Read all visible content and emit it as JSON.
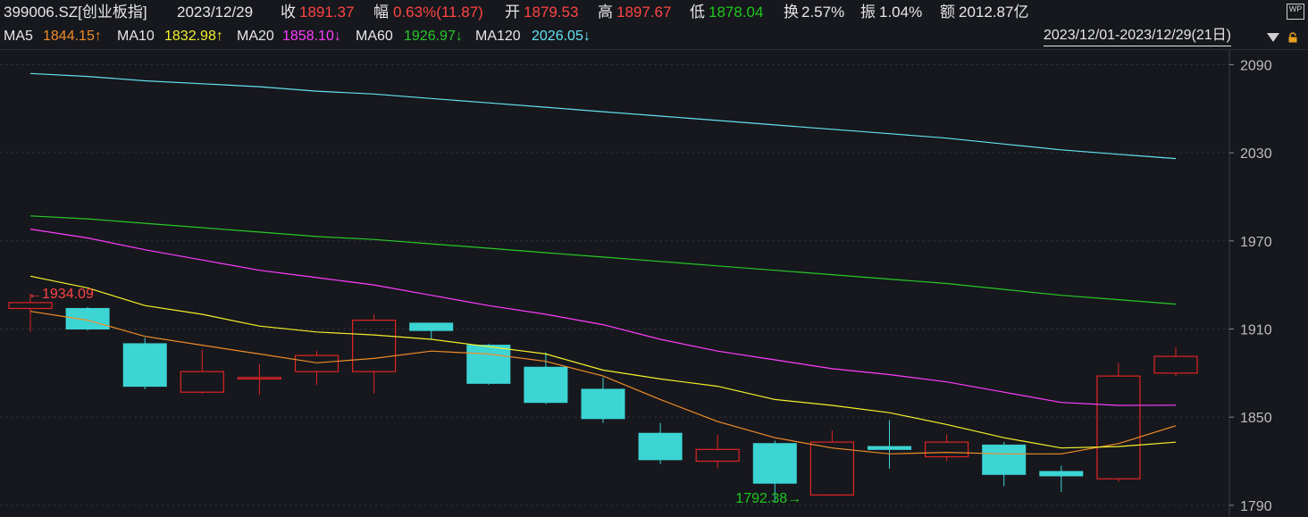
{
  "header": {
    "code": "399006.SZ[创业板指]",
    "date": "2023/12/29",
    "close_label": "收",
    "close_value": "1891.37",
    "change_label": "幅",
    "change_value": "0.63%(11.87)",
    "open_label": "开",
    "open_value": "1879.53",
    "high_label": "高",
    "high_value": "1897.67",
    "low_label": "低",
    "low_value": "1878.04",
    "turnover_label": "换",
    "turnover_value": "2.57%",
    "amplitude_label": "振",
    "amplitude_value": "1.04%",
    "amount_label": "额",
    "amount_value": "2012.87亿",
    "wp_icon_text": "WP"
  },
  "ma_bar": {
    "ma5_label": "MA5",
    "ma5_value": "1844.15↑",
    "ma10_label": "MA10",
    "ma10_value": "1832.98↑",
    "ma20_label": "MA20",
    "ma20_value": "1858.10↓",
    "ma60_label": "MA60",
    "ma60_value": "1926.97↓",
    "ma120_label": "MA120",
    "ma120_value": "2026.05↓",
    "range_text": "2023/12/01-2023/12/29(21日)"
  },
  "colors": {
    "up": "#e02424",
    "down": "#3dd4d4",
    "ma5": "#f08c28",
    "ma10": "#f5f02d",
    "ma20": "#ff3cff",
    "ma60": "#28c828",
    "ma120": "#64e1f0",
    "background": "#16181d",
    "grid": "#2c2f36"
  },
  "chart_data": {
    "type": "candlestick",
    "ylim": [
      1782,
      2100
    ],
    "y_ticks": [
      2090,
      2030,
      1970,
      1910,
      1850,
      1790
    ],
    "max_annotation": {
      "index": 0,
      "value": "1934.09",
      "text": "←1934.09"
    },
    "min_annotation": {
      "index": 13,
      "value": "1792.38",
      "text": "1792.38→"
    },
    "candles": [
      {
        "open": 1924,
        "close": 1928,
        "high": 1934.09,
        "low": 1908
      },
      {
        "open": 1924,
        "close": 1910,
        "high": 1925,
        "low": 1909
      },
      {
        "open": 1900,
        "close": 1871,
        "high": 1904,
        "low": 1869
      },
      {
        "open": 1867,
        "close": 1881,
        "high": 1896,
        "low": 1866
      },
      {
        "open": 1876,
        "close": 1877,
        "high": 1886,
        "low": 1865
      },
      {
        "open": 1881,
        "close": 1892,
        "high": 1895,
        "low": 1872
      },
      {
        "open": 1881,
        "close": 1916,
        "high": 1920,
        "low": 1866
      },
      {
        "open": 1914,
        "close": 1909,
        "high": 1914,
        "low": 1903
      },
      {
        "open": 1899,
        "close": 1873,
        "high": 1900,
        "low": 1872
      },
      {
        "open": 1884,
        "close": 1860,
        "high": 1894,
        "low": 1859
      },
      {
        "open": 1869,
        "close": 1849,
        "high": 1877,
        "low": 1846
      },
      {
        "open": 1839,
        "close": 1821,
        "high": 1846,
        "low": 1818
      },
      {
        "open": 1820,
        "close": 1828,
        "high": 1838,
        "low": 1815
      },
      {
        "open": 1832,
        "close": 1805,
        "high": 1834,
        "low": 1792.38
      },
      {
        "open": 1797,
        "close": 1833,
        "high": 1841,
        "low": 1796
      },
      {
        "open": 1830,
        "close": 1828,
        "high": 1848,
        "low": 1815
      },
      {
        "open": 1823,
        "close": 1833,
        "high": 1838,
        "low": 1820
      },
      {
        "open": 1831,
        "close": 1811,
        "high": 1833,
        "low": 1803
      },
      {
        "open": 1813,
        "close": 1810,
        "high": 1817,
        "low": 1799
      },
      {
        "open": 1808,
        "close": 1878,
        "high": 1887,
        "low": 1806
      },
      {
        "open": 1880,
        "close": 1891.37,
        "high": 1897.67,
        "low": 1878.04
      }
    ],
    "series": [
      {
        "name": "MA5",
        "values": [
          1922,
          1916,
          1905,
          1899,
          1893,
          1887,
          1890,
          1895,
          1893,
          1888,
          1878,
          1862,
          1847,
          1836,
          1829,
          1825,
          1826,
          1825,
          1825,
          1832,
          1844.15
        ]
      },
      {
        "name": "MA10",
        "values": [
          1946,
          1938,
          1926,
          1920,
          1912,
          1908,
          1906,
          1903,
          1898,
          1893,
          1882,
          1876,
          1871,
          1862,
          1858,
          1853,
          1845,
          1836,
          1829,
          1830,
          1832.98
        ]
      },
      {
        "name": "MA20",
        "values": [
          1978,
          1972,
          1964,
          1957,
          1950,
          1945,
          1940,
          1933,
          1926,
          1920,
          1913,
          1903,
          1895,
          1889,
          1883,
          1879,
          1874,
          1867,
          1860,
          1858,
          1858.1
        ]
      },
      {
        "name": "MA60",
        "values": [
          1987,
          1985,
          1982,
          1979,
          1976,
          1973,
          1971,
          1968,
          1965,
          1962,
          1959,
          1956,
          1953,
          1950,
          1947,
          1944,
          1941,
          1937,
          1933,
          1930,
          1926.97
        ]
      },
      {
        "name": "MA120",
        "values": [
          2084,
          2082,
          2079,
          2077,
          2075,
          2072,
          2070,
          2067,
          2064,
          2061,
          2058,
          2055,
          2052,
          2049,
          2046,
          2043,
          2040,
          2036,
          2032,
          2029,
          2026.05
        ]
      }
    ]
  }
}
